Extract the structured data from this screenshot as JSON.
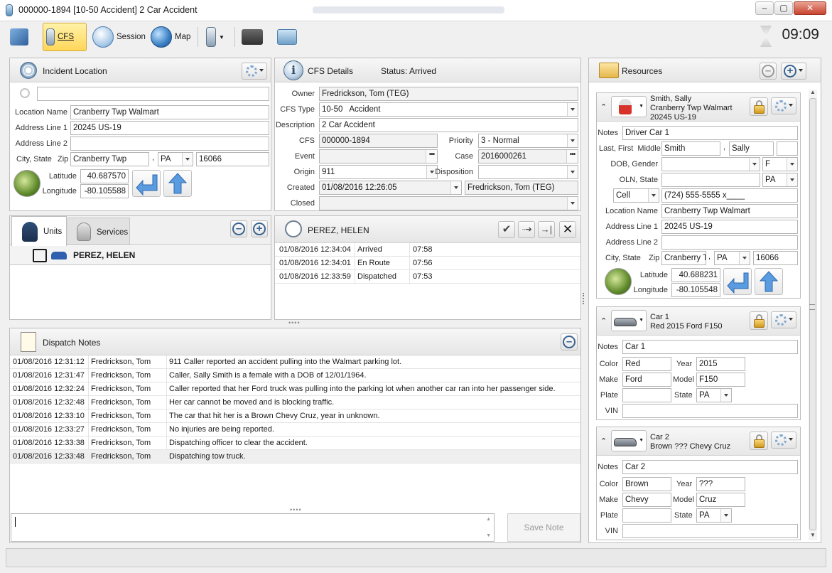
{
  "window": {
    "title": "000000-1894 [10-50   Accident] 2 Car Accident"
  },
  "toolbar": {
    "cfs": "CFS",
    "session": "Session",
    "map": "Map",
    "time": "09:09"
  },
  "incident": {
    "title": "Incident Location",
    "labels": {
      "location_name": "Location Name",
      "address1": "Address Line 1",
      "address2": "Address Line 2",
      "city_state": "City, State",
      "zip": "Zip",
      "latitude": "Latitude",
      "longitude": "Longitude"
    },
    "location_name": "Cranberry Twp Walmart",
    "address1": "20245 US-19",
    "address2": "",
    "city": "Cranberry Twp",
    "state": "PA",
    "zip": "16066",
    "latitude": "40.687570",
    "longitude": "-80.105588"
  },
  "cfs": {
    "title": "CFS Details",
    "status": "Status: Arrived",
    "labels": {
      "owner": "Owner",
      "cfs_type": "CFS Type",
      "description": "Description",
      "cfs": "CFS",
      "priority": "Priority",
      "event": "Event",
      "case": "Case",
      "origin": "Origin",
      "disposition": "Disposition",
      "created": "Created",
      "closed": "Closed"
    },
    "owner": "Fredrickson, Tom (TEG)",
    "cfs_type": "10-50   Accident",
    "description": "2 Car Accident",
    "cfs": "000000-1894",
    "priority": "3 - Normal",
    "event": "",
    "case": "2016000261",
    "origin": "911",
    "disposition": "",
    "created": "01/08/2016 12:26:05",
    "created_by": "Fredrickson, Tom (TEG)",
    "closed": ""
  },
  "units": {
    "tabs": [
      "Units",
      "Services"
    ],
    "items": [
      {
        "name": "PEREZ, HELEN"
      }
    ]
  },
  "unit_detail": {
    "title": "PEREZ, HELEN",
    "rows": [
      {
        "time": "01/08/2016 12:34:04",
        "status": "Arrived",
        "elapsed": "07:58"
      },
      {
        "time": "01/08/2016 12:34:01",
        "status": "En Route",
        "elapsed": "07:56"
      },
      {
        "time": "01/08/2016 12:33:59",
        "status": "Dispatched",
        "elapsed": "07:53"
      }
    ]
  },
  "notes": {
    "title": "Dispatch Notes",
    "save_label": "Save Note",
    "input_value": "",
    "rows": [
      {
        "time": "01/08/2016 12:31:12",
        "user": "Fredrickson, Tom",
        "text": "911 Caller reported an accident pulling into the Walmart parking lot."
      },
      {
        "time": "01/08/2016 12:31:47",
        "user": "Fredrickson, Tom",
        "text": "Caller, Sally Smith is a female with a DOB of 12/01/1964."
      },
      {
        "time": "01/08/2016 12:32:24",
        "user": "Fredrickson, Tom",
        "text": "Caller reported that her Ford truck was pulling into the parking lot when another car ran into her passenger side."
      },
      {
        "time": "01/08/2016 12:32:48",
        "user": "Fredrickson, Tom",
        "text": "Her car cannot be moved and is blocking traffic."
      },
      {
        "time": "01/08/2016 12:33:10",
        "user": "Fredrickson, Tom",
        "text": "The car that hit her is a Brown Chevy Cruz, year in unknown."
      },
      {
        "time": "01/08/2016 12:33:27",
        "user": "Fredrickson, Tom",
        "text": "No injuries are being reported."
      },
      {
        "time": "01/08/2016 12:33:38",
        "user": "Fredrickson, Tom",
        "text": "Dispatching officer to clear the accident."
      },
      {
        "time": "01/08/2016 12:33:48",
        "user": "Fredrickson, Tom",
        "text": "Dispatching tow truck."
      }
    ]
  },
  "resources": {
    "title": "Resources",
    "person": {
      "line1": "Smith, Sally",
      "line2": "Cranberry Twp Walmart",
      "line3": "20245 US-19",
      "labels": {
        "notes": "Notes",
        "last_first": "Last, First",
        "middle": "Middle",
        "dob_gender": "DOB, Gender",
        "oln_state": "OLN, State",
        "location_name": "Location Name",
        "address1": "Address Line 1",
        "address2": "Address Line 2",
        "city_state": "City, State",
        "zip": "Zip",
        "latitude": "Latitude",
        "longitude": "Longitude"
      },
      "notes": "Driver Car 1",
      "last": "Smith",
      "first": "Sally",
      "middle": "",
      "dob": "",
      "gender": "F",
      "oln": "",
      "oln_state": "PA",
      "phone_type": "Cell",
      "phone": "(724) 555-5555 x____",
      "location_name": "Cranberry Twp Walmart",
      "address1": "20245 US-19",
      "address2": "",
      "city": "Cranberry T",
      "state": "PA",
      "zip": "16066",
      "latitude": "40.688231",
      "longitude": "-80.105548"
    },
    "vehicle_labels": {
      "notes": "Notes",
      "color": "Color",
      "year": "Year",
      "make": "Make",
      "model": "Model",
      "plate": "Plate",
      "state": "State",
      "vin": "VIN"
    },
    "car1": {
      "line1": "Car 1",
      "line2": "Red 2015 Ford F150",
      "notes": "Car 1",
      "color": "Red",
      "year": "2015",
      "make": "Ford",
      "model": "F150",
      "plate": "",
      "state": "PA",
      "vin": ""
    },
    "car2": {
      "line1": "Car 2",
      "line2": "Brown ??? Chevy Cruz",
      "notes": "Car 2",
      "color": "Brown",
      "year": "???",
      "make": "Chevy",
      "model": "Cruz",
      "plate": "",
      "state": "PA",
      "vin": ""
    }
  }
}
